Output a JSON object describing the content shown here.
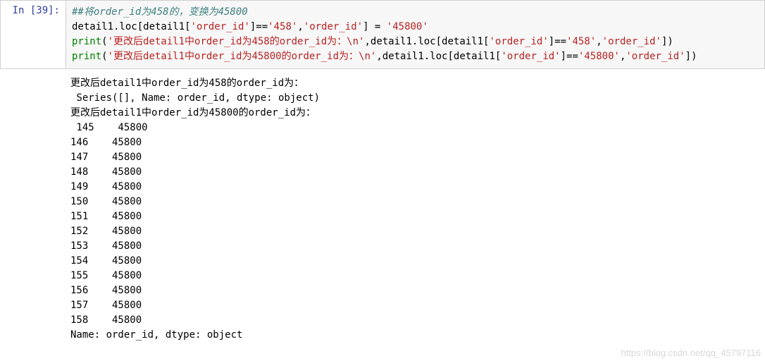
{
  "prompt": {
    "label": "In ",
    "number": "[39]:"
  },
  "code": {
    "line1_comment": "##将order_id为458的，变换为45800",
    "line2": {
      "p1": "detail1.loc[detail1[",
      "s1": "'order_id'",
      "p2": "]==",
      "s2": "'458'",
      "p3": ",",
      "s3": "'order_id'",
      "p4": "] = ",
      "s4": "'45800'"
    },
    "line3": {
      "f": "print",
      "p1": "(",
      "s1": "'更改后detail1中order_id为458的order_id为：\\n'",
      "p2": ",detail1.loc[detail1[",
      "s2": "'order_id'",
      "p3": "]==",
      "s3": "'458'",
      "p4": ",",
      "s4": "'order_id'",
      "p5": "])"
    },
    "line4": {
      "f": "print",
      "p1": "(",
      "s1": "'更改后detail1中order_id为45800的order_id为：\\n'",
      "p2": ",detail1.loc[detail1[",
      "s2": "'order_id'",
      "p3": "]==",
      "s3": "'45800'",
      "p4": ",",
      "s4": "'order_id'",
      "p5": "])"
    }
  },
  "output": {
    "header1": "更改后detail1中order_id为458的order_id为：",
    "series_empty": " Series([], Name: order_id, dtype: object)",
    "header2": "更改后detail1中order_id为45800的order_id为：",
    "rows": [
      {
        "idx": " 145",
        "val": "    45800"
      },
      {
        "idx": "146",
        "val": "    45800"
      },
      {
        "idx": "147",
        "val": "    45800"
      },
      {
        "idx": "148",
        "val": "    45800"
      },
      {
        "idx": "149",
        "val": "    45800"
      },
      {
        "idx": "150",
        "val": "    45800"
      },
      {
        "idx": "151",
        "val": "    45800"
      },
      {
        "idx": "152",
        "val": "    45800"
      },
      {
        "idx": "153",
        "val": "    45800"
      },
      {
        "idx": "154",
        "val": "    45800"
      },
      {
        "idx": "155",
        "val": "    45800"
      },
      {
        "idx": "156",
        "val": "    45800"
      },
      {
        "idx": "157",
        "val": "    45800"
      },
      {
        "idx": "158",
        "val": "    45800"
      }
    ],
    "footer": "Name: order_id, dtype: object"
  },
  "watermark": "https://blog.csdn.net/qq_45797116"
}
